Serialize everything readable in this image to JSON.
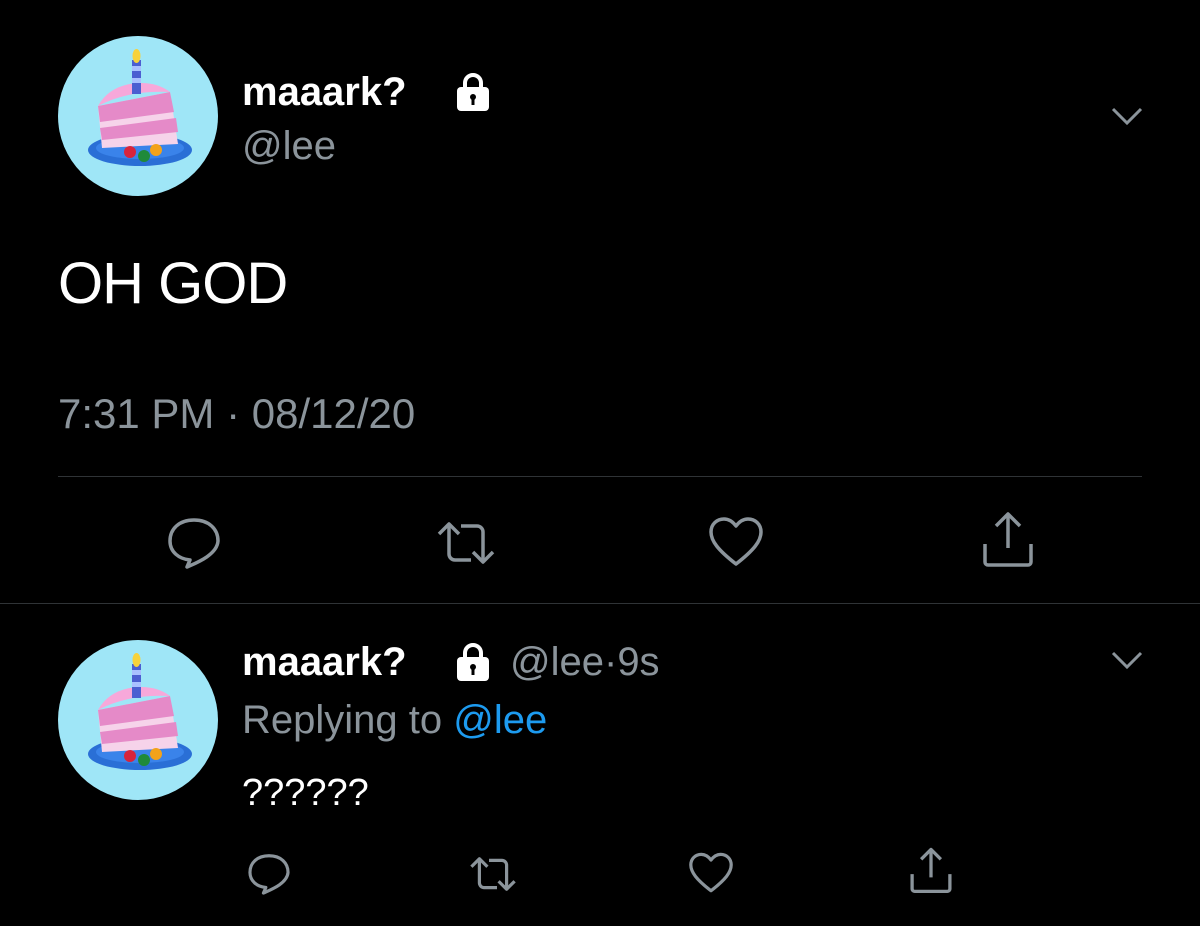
{
  "main_tweet": {
    "display_name": "maaark?",
    "handle": "@lee",
    "text": "OH GOD",
    "time": "7:31 PM",
    "separator": "·",
    "date": "08/12/20",
    "avatar_icon": "birthday-cake-avatar",
    "protected_icon": "lock-icon",
    "menu_icon": "chevron-down-icon"
  },
  "reply_tweet": {
    "display_name": "maaark?",
    "handle": "@lee",
    "separator": "·",
    "age": "9s",
    "replying_to_label": "Replying to",
    "replying_to_handle": "@lee",
    "text": "??????",
    "avatar_icon": "birthday-cake-avatar",
    "protected_icon": "lock-icon",
    "menu_icon": "chevron-down-icon"
  },
  "actions": [
    "reply-icon",
    "retweet-icon",
    "like-icon",
    "share-icon"
  ],
  "colors": {
    "background": "#000000",
    "text_primary": "#ffffff",
    "text_secondary": "#8b949b",
    "link": "#1d9bf0",
    "divider": "#2f3336",
    "avatar_bg": "#9fe6f7"
  }
}
